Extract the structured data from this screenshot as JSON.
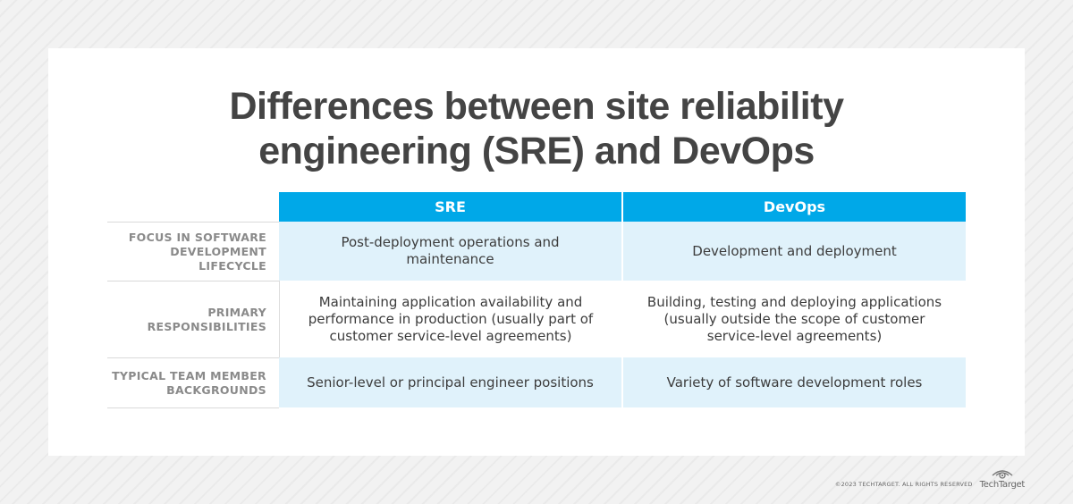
{
  "title": {
    "line1": "Differences between site reliability",
    "line2": "engineering (SRE) and DevOps"
  },
  "table": {
    "columns": [
      "SRE",
      "DevOps"
    ],
    "rows": [
      {
        "label": "FOCUS IN SOFTWARE DEVELOPMENT LIFECYCLE",
        "sre": "Post-deployment operations and maintenance",
        "devops": "Development and deployment"
      },
      {
        "label": "PRIMARY RESPONSIBILITIES",
        "sre": "Maintaining application availability and performance in production (usually part of customer service-level agreements)",
        "devops": "Building, testing and deploying applications (usually outside the scope of customer service-level agreements)"
      },
      {
        "label": "TYPICAL TEAM MEMBER BACKGROUNDS",
        "sre": "Senior-level or principal engineer positions",
        "devops": "Variety of software development roles"
      }
    ]
  },
  "footer": {
    "copyright": "©2023 TECHTARGET. ALL RIGHTS RESERVED",
    "brand": "TechTarget",
    "brand_icon": "eye-logo-icon"
  },
  "colors": {
    "header_bg": "#00a8e8",
    "shaded_row_bg": "#e0f2fb",
    "title_text": "#444444",
    "label_text": "#8a8a8a"
  }
}
